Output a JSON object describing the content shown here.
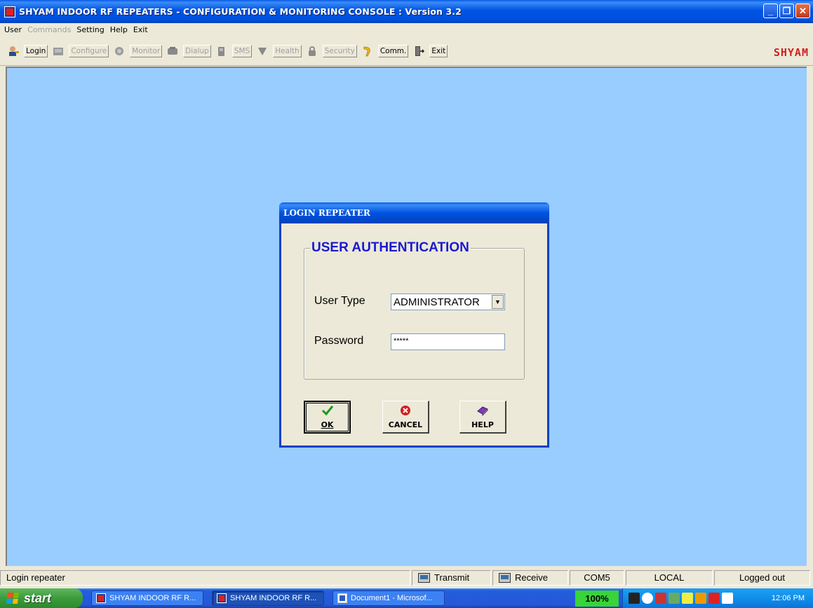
{
  "window": {
    "title": "SHYAM INDOOR RF REPEATERS - CONFIGURATION & MONITORING CONSOLE  : Version 3.2",
    "minimize": "_",
    "restore": "❐",
    "close": "✕"
  },
  "menu": {
    "user": "User",
    "commands": "Commands",
    "setting": "Setting",
    "help": "Help",
    "exit": "Exit"
  },
  "toolbar": {
    "login": "Login",
    "configure": "Configure",
    "monitor": "Monitor",
    "dialup": "Dialup",
    "sms": "SMS",
    "health": "Health",
    "security": "Security",
    "comm": "Comm.",
    "exit": "Exit",
    "brand": "SHYAM"
  },
  "dialog": {
    "title": "LOGIN REPEATER",
    "group_title": "USER AUTHENTICATION",
    "user_type_label": "User Type",
    "user_type_value": "ADMINISTRATOR",
    "password_label": "Password",
    "password_value": "*****",
    "ok_label": "OK",
    "cancel_label": "CANCEL",
    "help_label": "HELP"
  },
  "statusbar": {
    "message": "Login repeater",
    "transmit": "Transmit",
    "receive": "Receive",
    "port": "COM5",
    "mode": "LOCAL",
    "login_state": "Logged out"
  },
  "taskbar": {
    "start": "start",
    "tasks": [
      "SHYAM INDOOR RF R...",
      "SHYAM INDOOR RF R...",
      "Document1 - Microsof..."
    ],
    "battery": "100%",
    "clock": "12:06 PM"
  }
}
